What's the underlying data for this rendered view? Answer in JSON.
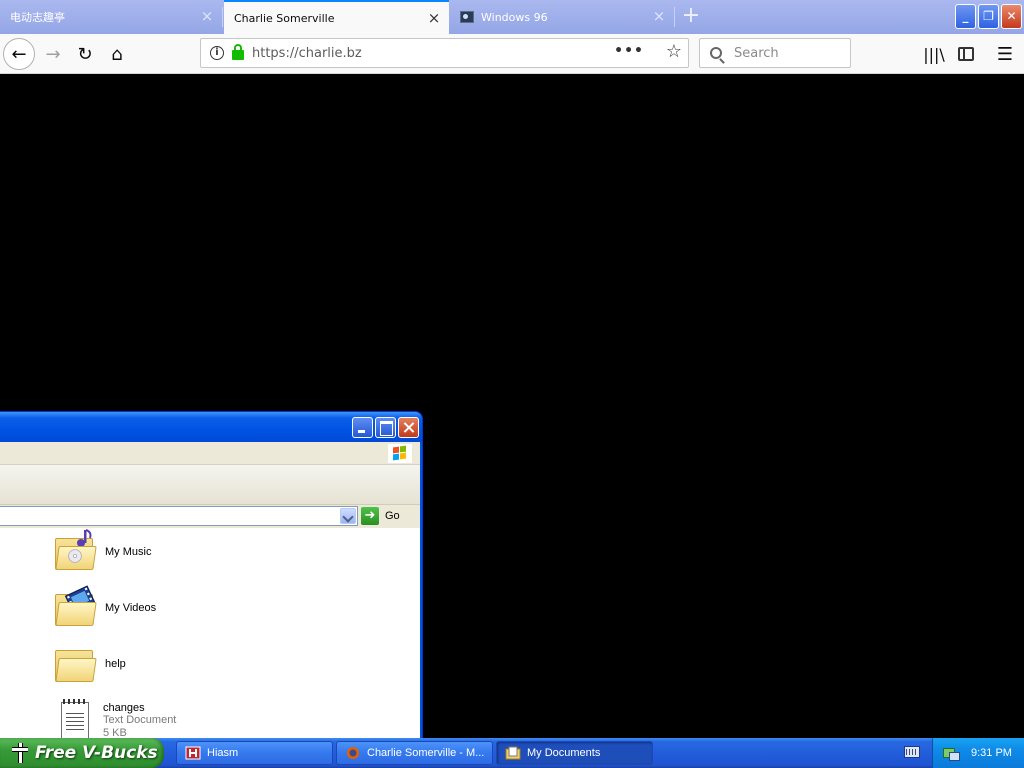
{
  "browser": {
    "tabs": [
      {
        "label": "电动志趣亭",
        "active": false
      },
      {
        "label": "Charlie Somerville",
        "active": true
      },
      {
        "label": "Windows 96",
        "active": false
      }
    ],
    "url": "https://charlie.bz",
    "search_placeholder": "Search",
    "icons": {
      "back": "arrow-left-icon",
      "forward": "arrow-right-icon",
      "reload": "reload-icon",
      "home": "home-icon",
      "info": "info-icon",
      "lock": "lock-icon",
      "page_actions": "ellipsis-icon",
      "bookmark": "star-icon",
      "search": "search-icon",
      "library": "library-icon",
      "sidebar": "sidebar-icon",
      "menu": "hamburger-icon",
      "new_tab": "plus-icon"
    },
    "accent_color": "#0a84ff"
  },
  "explorer": {
    "address_go_label": "Go",
    "items": [
      {
        "name": "My Music",
        "icon": "music-folder-icon"
      },
      {
        "name": "My Videos",
        "icon": "video-folder-icon"
      },
      {
        "name": "help",
        "icon": "folder-icon"
      },
      {
        "name": "changes",
        "type": "Text Document",
        "size": "5 KB",
        "icon": "text-document-icon"
      }
    ]
  },
  "taskbar": {
    "start_label": "Free V-Bucks",
    "buttons": [
      {
        "label": "Hiasm",
        "active": false
      },
      {
        "label": "Charlie Somerville - M...",
        "active": false
      },
      {
        "label": "My Documents",
        "active": true
      }
    ],
    "clock": "9:31 PM",
    "colors": {
      "start": "#379b37",
      "bar": "#245ddb",
      "tray": "#0f8ae8"
    }
  }
}
